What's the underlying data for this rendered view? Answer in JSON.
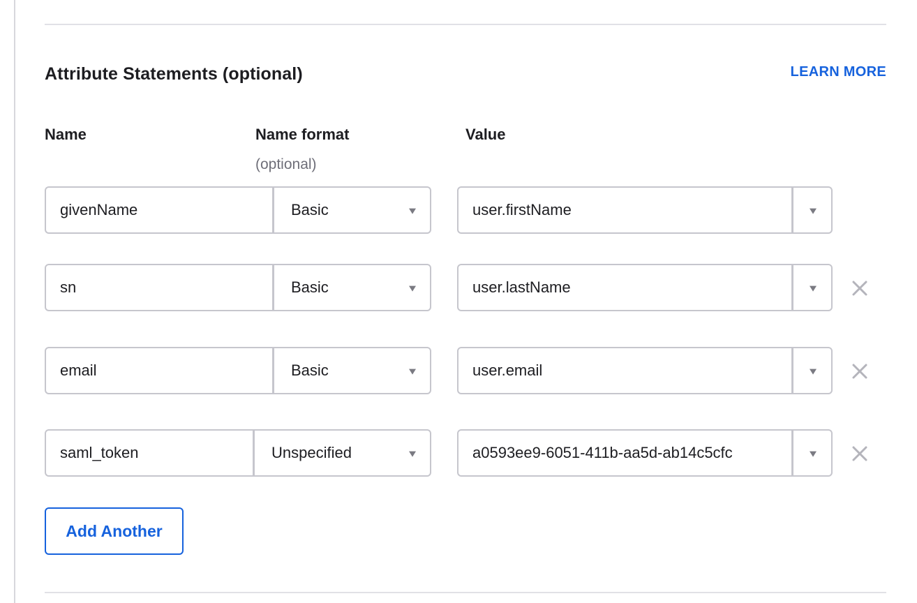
{
  "section": {
    "title": "Attribute Statements (optional)",
    "learn_more": "LEARN MORE"
  },
  "columns": {
    "name": "Name",
    "name_format": "Name format",
    "name_format_hint": "(optional)",
    "value": "Value"
  },
  "rows": [
    {
      "name": "givenName",
      "format": "Basic",
      "value": "user.firstName",
      "removable": false
    },
    {
      "name": "sn",
      "format": "Basic",
      "value": "user.lastName",
      "removable": true
    },
    {
      "name": "email",
      "format": "Basic",
      "value": "user.email",
      "removable": true
    },
    {
      "name": "saml_token",
      "format": "Unspecified",
      "value": "a0593ee9-6051-411b-aa5d-ab14c5cfc",
      "removable": true
    }
  ],
  "actions": {
    "add_another": "Add Another"
  },
  "colors": {
    "accent": "#1662dd",
    "border": "#c6c6cd",
    "muted_text": "#6e6e78",
    "remove_icon": "#b4b4bb"
  },
  "icons": {
    "remove": "close-x-icon",
    "dropdown": "caret-down-icon"
  }
}
